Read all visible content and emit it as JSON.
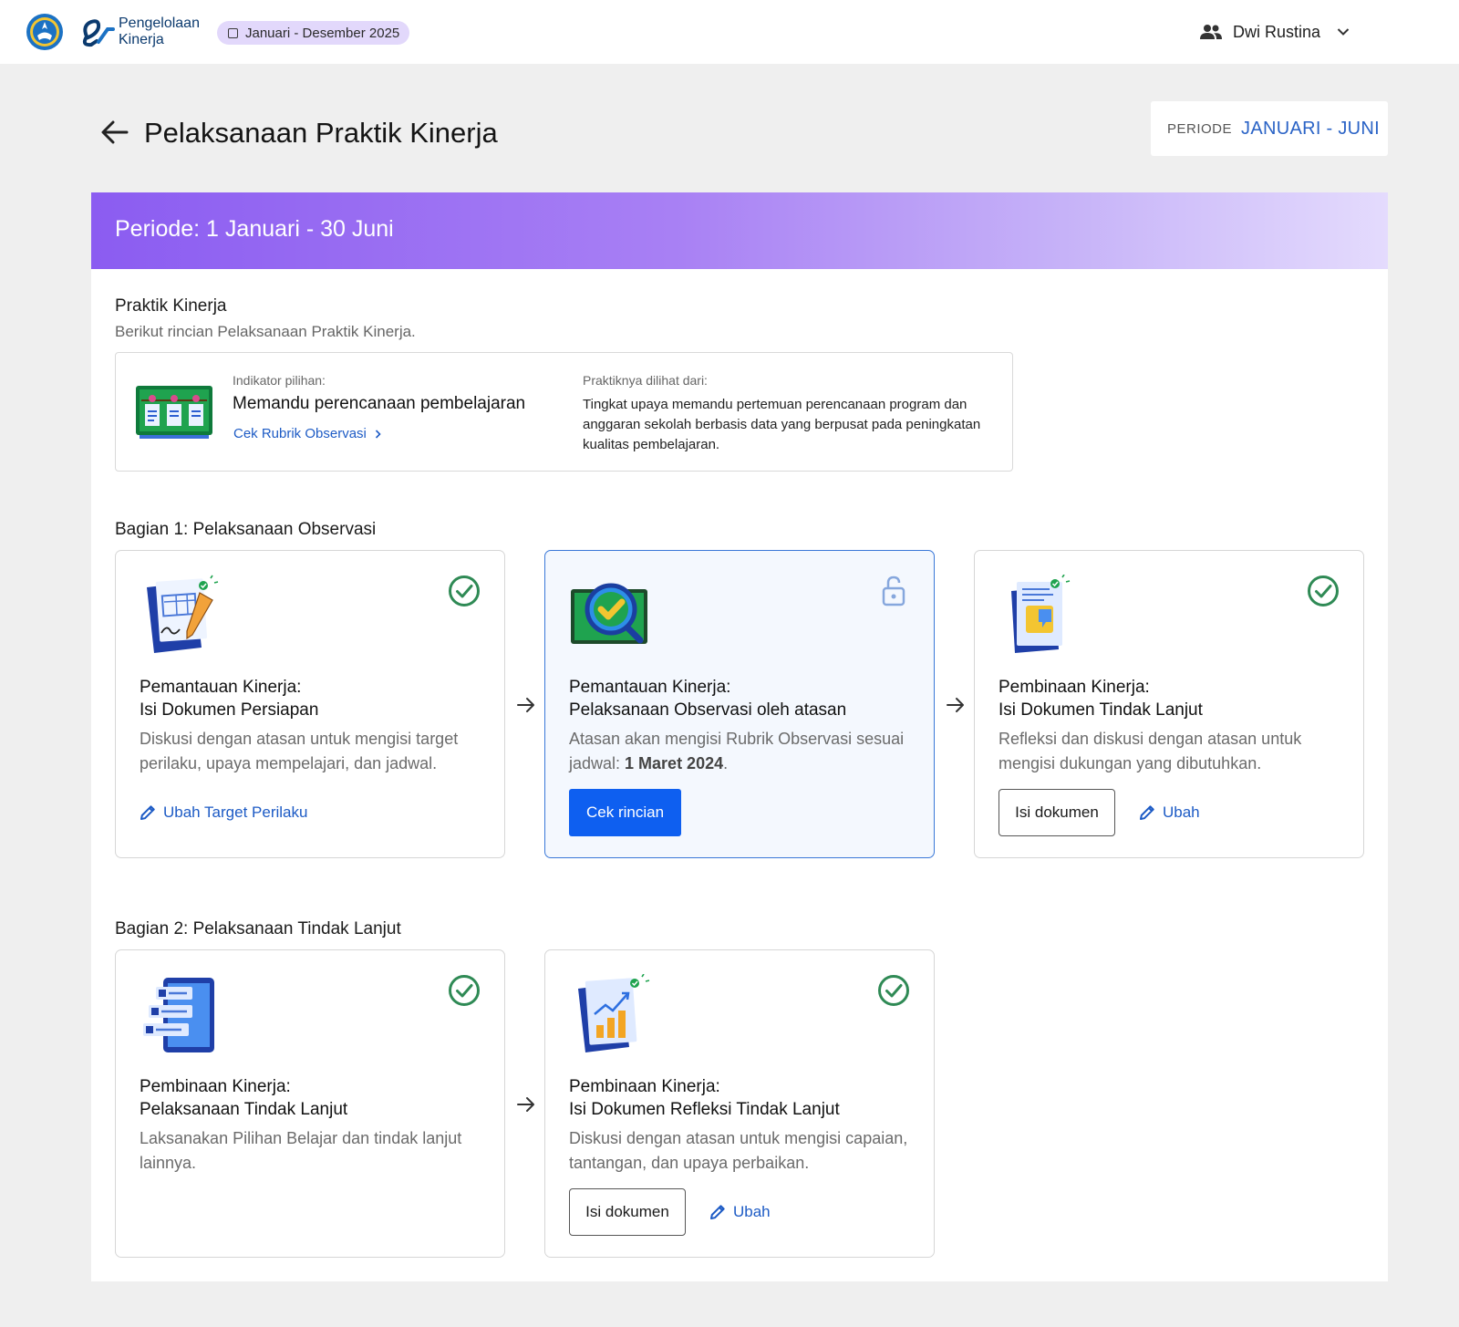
{
  "header": {
    "brand_line1": "Pengelolaan",
    "brand_line2": "Kinerja",
    "period_chip": "Januari - Desember 2025",
    "user_name": "Dwi Rustina"
  },
  "page": {
    "title": "Pelaksanaan Praktik Kinerja",
    "periode_label": "PERIODE",
    "periode_value": "JANUARI - JUNI"
  },
  "banner": {
    "text": "Periode: 1 Januari - 30 Juni"
  },
  "praktik": {
    "title": "Praktik Kinerja",
    "subtitle": "Berikut rincian Pelaksanaan Praktik Kinerja.",
    "indikator_label": "Indikator pilihan:",
    "indikator_value": "Memandu perencanaan pembelajaran",
    "rubrik_link": "Cek Rubrik Observasi",
    "dilihat_label": "Praktiknya dilihat dari:",
    "dilihat_value": "Tingkat upaya memandu pertemuan perencanaan program dan anggaran sekolah berbasis data yang berpusat pada peningkatan kualitas pembelajaran."
  },
  "bagian1": {
    "title": "Bagian 1: Pelaksanaan Observasi",
    "cards": [
      {
        "title_line1": "Pemantauan Kinerja:",
        "title_line2": "Isi Dokumen Persiapan",
        "desc": "Diskusi dengan atasan untuk mengisi target perilaku, upaya mempelajari, dan jadwal.",
        "status": "completed",
        "edit_link": "Ubah Target Perilaku"
      },
      {
        "title_line1": "Pemantauan Kinerja:",
        "title_line2": "Pelaksanaan Observasi oleh atasan",
        "desc_before": "Atasan akan mengisi Rubrik Observasi sesuai jadwal: ",
        "desc_bold": "1 Maret 2024",
        "desc_after": ".",
        "status": "unlocked",
        "primary_button": "Cek rincian"
      },
      {
        "title_line1": "Pembinaan Kinerja:",
        "title_line2": "Isi Dokumen Tindak Lanjut",
        "desc": "Refleksi dan diskusi dengan atasan untuk mengisi dukungan yang dibutuhkan.",
        "status": "completed",
        "outline_button": "Isi dokumen",
        "edit_link": "Ubah"
      }
    ]
  },
  "bagian2": {
    "title": "Bagian 2: Pelaksanaan Tindak Lanjut",
    "cards": [
      {
        "title_line1": "Pembinaan Kinerja:",
        "title_line2": "Pelaksanaan Tindak Lanjut",
        "desc": "Laksanakan Pilihan Belajar dan tindak lanjut lainnya.",
        "status": "completed"
      },
      {
        "title_line1": "Pembinaan Kinerja:",
        "title_line2": "Isi Dokumen Refleksi Tindak Lanjut",
        "desc": "Diskusi dengan atasan untuk mengisi capaian, tantangan, dan upaya perbaikan.",
        "status": "completed",
        "outline_button": "Isi dokumen",
        "edit_link": "Ubah"
      }
    ]
  },
  "colors": {
    "accent_blue": "#0e5ff0",
    "link_blue": "#1d5bc5",
    "success_green": "#2f8a55",
    "banner_purple": "#8b5cf1",
    "chip_lavender": "#e2d8fb"
  }
}
